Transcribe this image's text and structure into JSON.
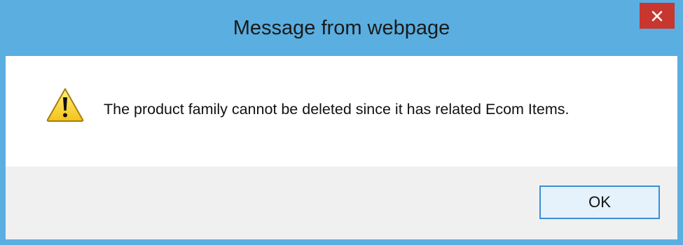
{
  "window": {
    "title": "Message from webpage",
    "close_icon": "close-icon",
    "close_color": "#c7372f",
    "frame_color": "#5aaee0"
  },
  "message": {
    "icon": "warning-icon",
    "text": "The product family cannot be deleted since it has related Ecom Items."
  },
  "buttons": {
    "ok_label": "OK"
  }
}
